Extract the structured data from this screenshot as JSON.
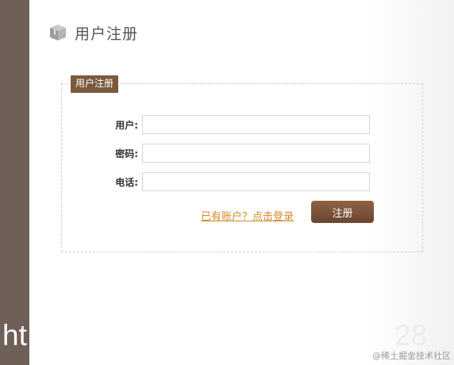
{
  "page": {
    "title": "用户注册"
  },
  "form": {
    "legend": "用户注册",
    "fields": [
      {
        "label": "用户:",
        "value": ""
      },
      {
        "label": "密码:",
        "value": ""
      },
      {
        "label": "电话:",
        "value": ""
      }
    ],
    "login_link": "已有账户？点击登录",
    "submit_label": "注册"
  },
  "overlay": {
    "left_text": "ht",
    "right_text": "28"
  },
  "watermark": "@稀土掘金技术社区",
  "colors": {
    "sidebar": "#6e5f57",
    "accent_brown": "#7a5a3e",
    "link_orange": "#d38a2a"
  },
  "icons": {
    "header_icon": "box-icon"
  }
}
